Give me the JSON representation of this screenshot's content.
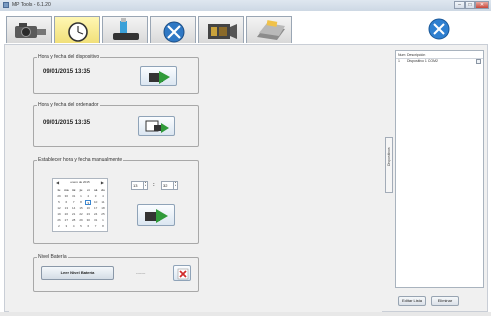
{
  "window": {
    "title": "MP Tools - 6.1.20",
    "minimize": "–",
    "maximize": "□",
    "close": "✕"
  },
  "toolbar": {
    "tabs": [
      {
        "icon": "camera-icon"
      },
      {
        "icon": "clock-icon",
        "active": true
      },
      {
        "icon": "usb-device-icon"
      },
      {
        "icon": "tools-icon"
      },
      {
        "icon": "video-icon"
      },
      {
        "icon": "folder-icon"
      }
    ],
    "settings_icon": "settings-icon"
  },
  "device_datetime": {
    "legend": "Hora y fecha del dispositivo",
    "value": "09/01/2015  13:35"
  },
  "pc_datetime": {
    "legend": "Hora y fecha del ordenador",
    "value": "09/01/2015  13:35"
  },
  "manual_datetime": {
    "legend": "Establecer hora y fecha manualmente",
    "calendar": {
      "month": "enero de 2015",
      "weekdays": [
        "lu",
        "ma",
        "mi",
        "ju",
        "vi",
        "sá",
        "do"
      ],
      "weeks": [
        [
          "29",
          "30",
          "31",
          "1",
          "2",
          "3",
          "4"
        ],
        [
          "5",
          "6",
          "7",
          "8",
          "9",
          "10",
          "11"
        ],
        [
          "12",
          "13",
          "14",
          "15",
          "16",
          "17",
          "18"
        ],
        [
          "19",
          "20",
          "21",
          "22",
          "23",
          "24",
          "25"
        ],
        [
          "26",
          "27",
          "28",
          "29",
          "30",
          "31",
          "1"
        ],
        [
          "2",
          "3",
          "4",
          "5",
          "6",
          "7",
          "8"
        ]
      ]
    },
    "hour": "13",
    "minute": "32",
    "separator": ":"
  },
  "battery": {
    "legend": "Nivel Batería",
    "read_button": "Leer Nivel Batería",
    "value": "-------"
  },
  "side_tab": {
    "label": "Dispositivos"
  },
  "device_list": {
    "columns": [
      "Num",
      "Descripción"
    ],
    "rows": [
      {
        "num": "1",
        "desc": "Dispositivo 1 COM2"
      }
    ],
    "edit_button": "Editar Lista",
    "delete_button": "Eliminar"
  },
  "colors": {
    "accent": "#2a7fd0",
    "active_tab": "#f1e07a",
    "green_arrow": "#2f9a3a",
    "red_x": "#d22c2c"
  }
}
